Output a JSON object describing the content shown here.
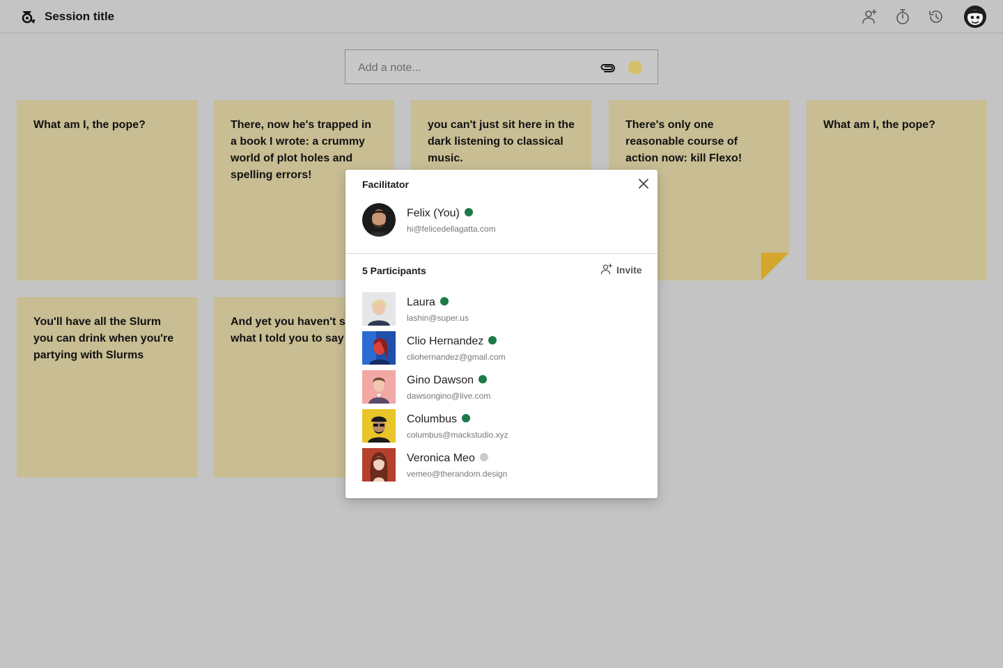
{
  "header": {
    "title": "Session title",
    "icons": [
      "add-participant-icon",
      "timer-icon",
      "history-icon",
      "user-avatar"
    ]
  },
  "note_bar": {
    "placeholder": "Add a note...",
    "attach_icon": "paperclip-icon",
    "color": "#d6bf6b"
  },
  "notes": [
    {
      "text": "What am I, the pope?"
    },
    {
      "text": "There, now he's trapped in a book I wrote: a crummy world of plot holes and spelling errors!"
    },
    {
      "text": "you can't just sit here in the dark listening to classical music."
    },
    {
      "text": "There's only one reasonable course of action now: kill Flexo!"
    },
    {
      "text": "What am I, the pope?"
    },
    {
      "text": "You'll have all the Slurm you can drink when you're partying with Slurms"
    },
    {
      "text": "And yet you haven't said what I told you to say"
    }
  ],
  "popup": {
    "facilitator_title": "Facilitator",
    "facilitator": {
      "name": "Felix (You)",
      "email": "hi@felicedellagatta.com",
      "online": true
    },
    "participants_title": "5 Participants",
    "invite_label": "Invite",
    "participants": [
      {
        "name": "Laura",
        "email": "lashin@super.us",
        "online": true
      },
      {
        "name": "Clio Hernandez",
        "email": "cliohernandez@gmail.com",
        "online": true
      },
      {
        "name": "Gino Dawson",
        "email": "dawsongino@live.com",
        "online": true
      },
      {
        "name": "Columbus",
        "email": "columbus@mackstudio.xyz",
        "online": true
      },
      {
        "name": "Veronica Meo",
        "email": "vemeo@therandom.design",
        "online": false
      }
    ]
  },
  "colors": {
    "background": "#c4c4c4",
    "sticky": "#c8bd93",
    "sticky_fold": "#d4a72c",
    "online": "#1c7a47",
    "offline": "#cccccc"
  }
}
